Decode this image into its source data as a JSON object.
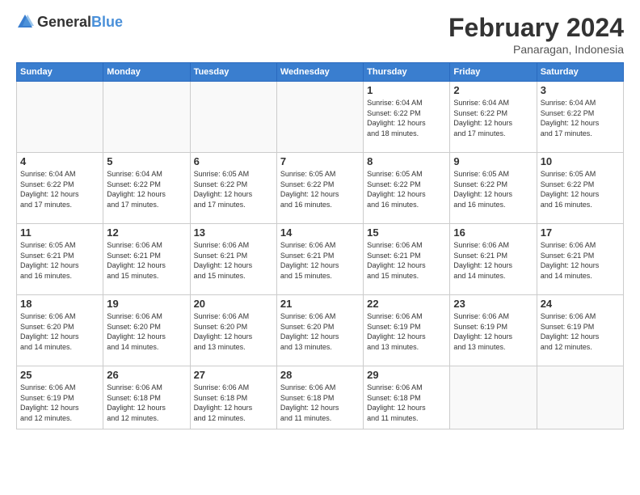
{
  "header": {
    "logo_general": "General",
    "logo_blue": "Blue",
    "title": "February 2024",
    "location": "Panaragan, Indonesia"
  },
  "weekdays": [
    "Sunday",
    "Monday",
    "Tuesday",
    "Wednesday",
    "Thursday",
    "Friday",
    "Saturday"
  ],
  "weeks": [
    [
      {
        "day": "",
        "info": ""
      },
      {
        "day": "",
        "info": ""
      },
      {
        "day": "",
        "info": ""
      },
      {
        "day": "",
        "info": ""
      },
      {
        "day": "1",
        "info": "Sunrise: 6:04 AM\nSunset: 6:22 PM\nDaylight: 12 hours\nand 18 minutes."
      },
      {
        "day": "2",
        "info": "Sunrise: 6:04 AM\nSunset: 6:22 PM\nDaylight: 12 hours\nand 17 minutes."
      },
      {
        "day": "3",
        "info": "Sunrise: 6:04 AM\nSunset: 6:22 PM\nDaylight: 12 hours\nand 17 minutes."
      }
    ],
    [
      {
        "day": "4",
        "info": "Sunrise: 6:04 AM\nSunset: 6:22 PM\nDaylight: 12 hours\nand 17 minutes."
      },
      {
        "day": "5",
        "info": "Sunrise: 6:04 AM\nSunset: 6:22 PM\nDaylight: 12 hours\nand 17 minutes."
      },
      {
        "day": "6",
        "info": "Sunrise: 6:05 AM\nSunset: 6:22 PM\nDaylight: 12 hours\nand 17 minutes."
      },
      {
        "day": "7",
        "info": "Sunrise: 6:05 AM\nSunset: 6:22 PM\nDaylight: 12 hours\nand 16 minutes."
      },
      {
        "day": "8",
        "info": "Sunrise: 6:05 AM\nSunset: 6:22 PM\nDaylight: 12 hours\nand 16 minutes."
      },
      {
        "day": "9",
        "info": "Sunrise: 6:05 AM\nSunset: 6:22 PM\nDaylight: 12 hours\nand 16 minutes."
      },
      {
        "day": "10",
        "info": "Sunrise: 6:05 AM\nSunset: 6:22 PM\nDaylight: 12 hours\nand 16 minutes."
      }
    ],
    [
      {
        "day": "11",
        "info": "Sunrise: 6:05 AM\nSunset: 6:21 PM\nDaylight: 12 hours\nand 16 minutes."
      },
      {
        "day": "12",
        "info": "Sunrise: 6:06 AM\nSunset: 6:21 PM\nDaylight: 12 hours\nand 15 minutes."
      },
      {
        "day": "13",
        "info": "Sunrise: 6:06 AM\nSunset: 6:21 PM\nDaylight: 12 hours\nand 15 minutes."
      },
      {
        "day": "14",
        "info": "Sunrise: 6:06 AM\nSunset: 6:21 PM\nDaylight: 12 hours\nand 15 minutes."
      },
      {
        "day": "15",
        "info": "Sunrise: 6:06 AM\nSunset: 6:21 PM\nDaylight: 12 hours\nand 15 minutes."
      },
      {
        "day": "16",
        "info": "Sunrise: 6:06 AM\nSunset: 6:21 PM\nDaylight: 12 hours\nand 14 minutes."
      },
      {
        "day": "17",
        "info": "Sunrise: 6:06 AM\nSunset: 6:21 PM\nDaylight: 12 hours\nand 14 minutes."
      }
    ],
    [
      {
        "day": "18",
        "info": "Sunrise: 6:06 AM\nSunset: 6:20 PM\nDaylight: 12 hours\nand 14 minutes."
      },
      {
        "day": "19",
        "info": "Sunrise: 6:06 AM\nSunset: 6:20 PM\nDaylight: 12 hours\nand 14 minutes."
      },
      {
        "day": "20",
        "info": "Sunrise: 6:06 AM\nSunset: 6:20 PM\nDaylight: 12 hours\nand 13 minutes."
      },
      {
        "day": "21",
        "info": "Sunrise: 6:06 AM\nSunset: 6:20 PM\nDaylight: 12 hours\nand 13 minutes."
      },
      {
        "day": "22",
        "info": "Sunrise: 6:06 AM\nSunset: 6:19 PM\nDaylight: 12 hours\nand 13 minutes."
      },
      {
        "day": "23",
        "info": "Sunrise: 6:06 AM\nSunset: 6:19 PM\nDaylight: 12 hours\nand 13 minutes."
      },
      {
        "day": "24",
        "info": "Sunrise: 6:06 AM\nSunset: 6:19 PM\nDaylight: 12 hours\nand 12 minutes."
      }
    ],
    [
      {
        "day": "25",
        "info": "Sunrise: 6:06 AM\nSunset: 6:19 PM\nDaylight: 12 hours\nand 12 minutes."
      },
      {
        "day": "26",
        "info": "Sunrise: 6:06 AM\nSunset: 6:18 PM\nDaylight: 12 hours\nand 12 minutes."
      },
      {
        "day": "27",
        "info": "Sunrise: 6:06 AM\nSunset: 6:18 PM\nDaylight: 12 hours\nand 12 minutes."
      },
      {
        "day": "28",
        "info": "Sunrise: 6:06 AM\nSunset: 6:18 PM\nDaylight: 12 hours\nand 11 minutes."
      },
      {
        "day": "29",
        "info": "Sunrise: 6:06 AM\nSunset: 6:18 PM\nDaylight: 12 hours\nand 11 minutes."
      },
      {
        "day": "",
        "info": ""
      },
      {
        "day": "",
        "info": ""
      }
    ]
  ]
}
